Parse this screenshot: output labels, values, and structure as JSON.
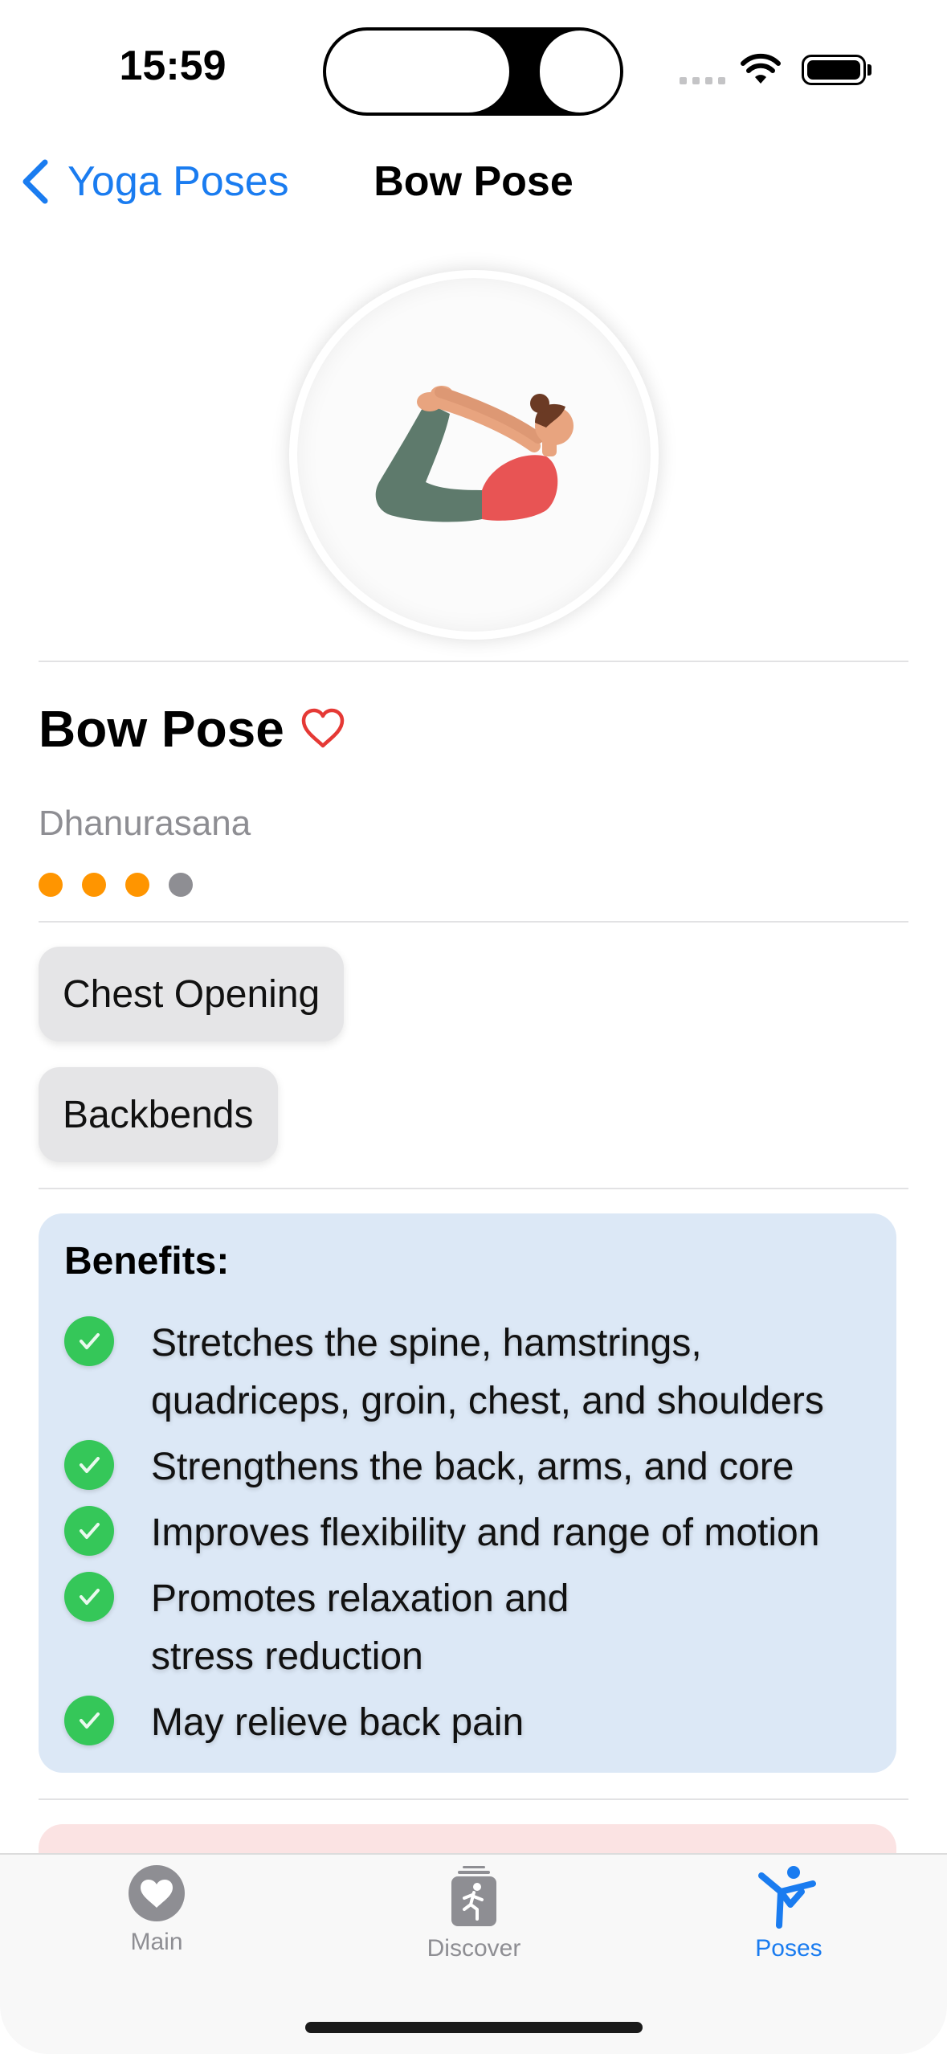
{
  "status_bar": {
    "time": "15:59"
  },
  "nav": {
    "back_label": "Yoga Poses",
    "title": "Bow Pose"
  },
  "pose": {
    "name": "Bow Pose",
    "sanskrit": "Dhanurasana",
    "difficulty": {
      "level": 3,
      "max": 4
    },
    "tags": [
      "Chest Opening",
      "Backbends"
    ]
  },
  "benefits": {
    "title": "Benefits:",
    "items": [
      "Stretches the spine, hamstrings, quadriceps, groin, chest, and shoulders",
      "Strengthens the back, arms, and core",
      "Improves flexibility and range of motion",
      "Promotes relaxation and stress reduction",
      "May relieve back pain"
    ]
  },
  "tabbar": {
    "tabs": [
      {
        "label": "Main",
        "icon": "heart-icon",
        "active": false
      },
      {
        "label": "Discover",
        "icon": "runner-card-icon",
        "active": false
      },
      {
        "label": "Poses",
        "icon": "yoga-pose-icon",
        "active": true
      }
    ]
  },
  "colors": {
    "accent": "#1a7cf0",
    "difficulty_on": "#ff9500",
    "difficulty_off": "#8e8e93",
    "check": "#35c759",
    "heart": "#e53935",
    "benefits_bg": "#dce8f6"
  }
}
